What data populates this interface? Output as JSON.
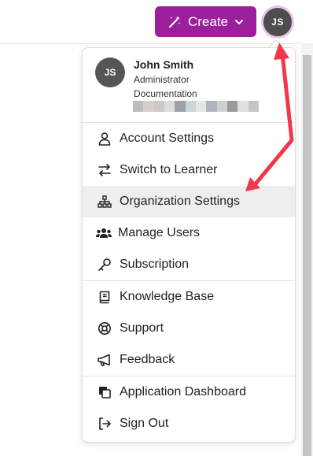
{
  "header": {
    "create_label": "Create",
    "avatar_initials": "JS"
  },
  "user": {
    "initials": "JS",
    "name": "John Smith",
    "role": "Administrator",
    "org": "Documentation",
    "redacted_colors": [
      "#bcbcbc",
      "#d6d0c8",
      "#c9c9c9",
      "#dcdcdc",
      "#a0a0a8",
      "#cbd6da",
      "#e6e6e6",
      "#b0b6c0",
      "#d0d0d0",
      "#9a9a9a",
      "#e0e0e0",
      "#c0c6cc"
    ]
  },
  "menu": {
    "account_settings": "Account Settings",
    "switch_to_learner": "Switch to Learner",
    "organization_settings": "Organization Settings",
    "manage_users": "Manage Users",
    "subscription": "Subscription",
    "knowledge_base": "Knowledge Base",
    "support": "Support",
    "feedback": "Feedback",
    "application_dashboard": "Application Dashboard",
    "sign_out": "Sign Out"
  },
  "colors": {
    "brand": "#9b1f9b",
    "annotation_arrow": "#f0384a",
    "active_row": "#eeeeee"
  }
}
